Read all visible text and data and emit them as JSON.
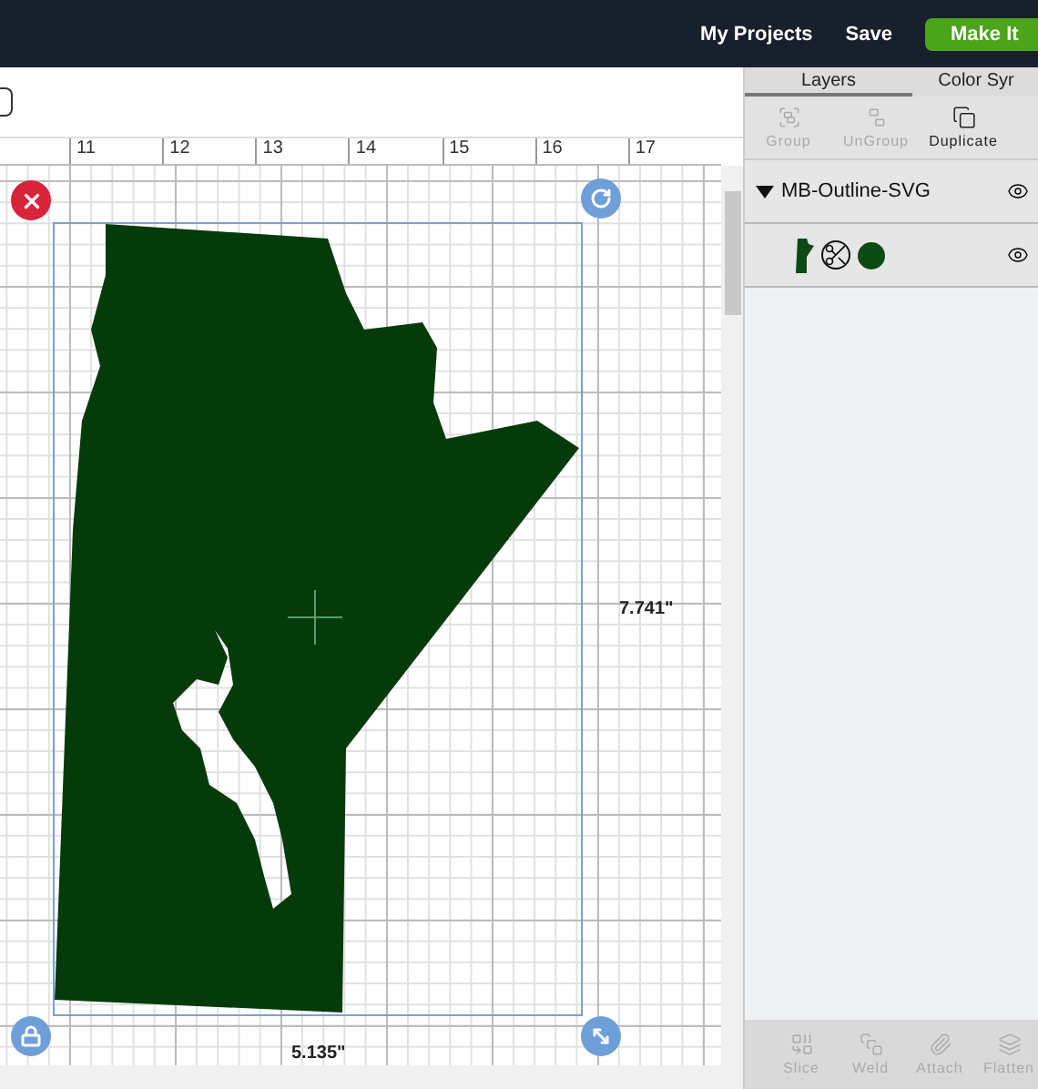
{
  "header": {
    "links": [
      "My Projects",
      "Save"
    ],
    "primary_button": "Make It"
  },
  "ruler": {
    "marks": [
      "11",
      "12",
      "13",
      "14",
      "15",
      "16",
      "17"
    ]
  },
  "canvas": {
    "height_label": "7.741\"",
    "width_label": "5.135\""
  },
  "panel": {
    "tabs": [
      {
        "label": "Layers",
        "selected": true
      },
      {
        "label": "Color Syr",
        "selected": false
      }
    ],
    "tools": [
      {
        "label": "Group",
        "disabled": true
      },
      {
        "label": "UnGroup",
        "disabled": true
      },
      {
        "label": "Duplicate",
        "disabled": false
      }
    ],
    "layer_group": {
      "name": "MB-Outline-SVG",
      "expanded": true,
      "visible": true,
      "children": [
        {
          "visible": true,
          "color": "#0b4a12"
        }
      ]
    },
    "bottom_tools": [
      {
        "label": "Slice",
        "disabled": true
      },
      {
        "label": "Weld",
        "disabled": true
      },
      {
        "label": "Attach",
        "disabled": true
      },
      {
        "label": "Flatten",
        "disabled": true
      }
    ]
  }
}
